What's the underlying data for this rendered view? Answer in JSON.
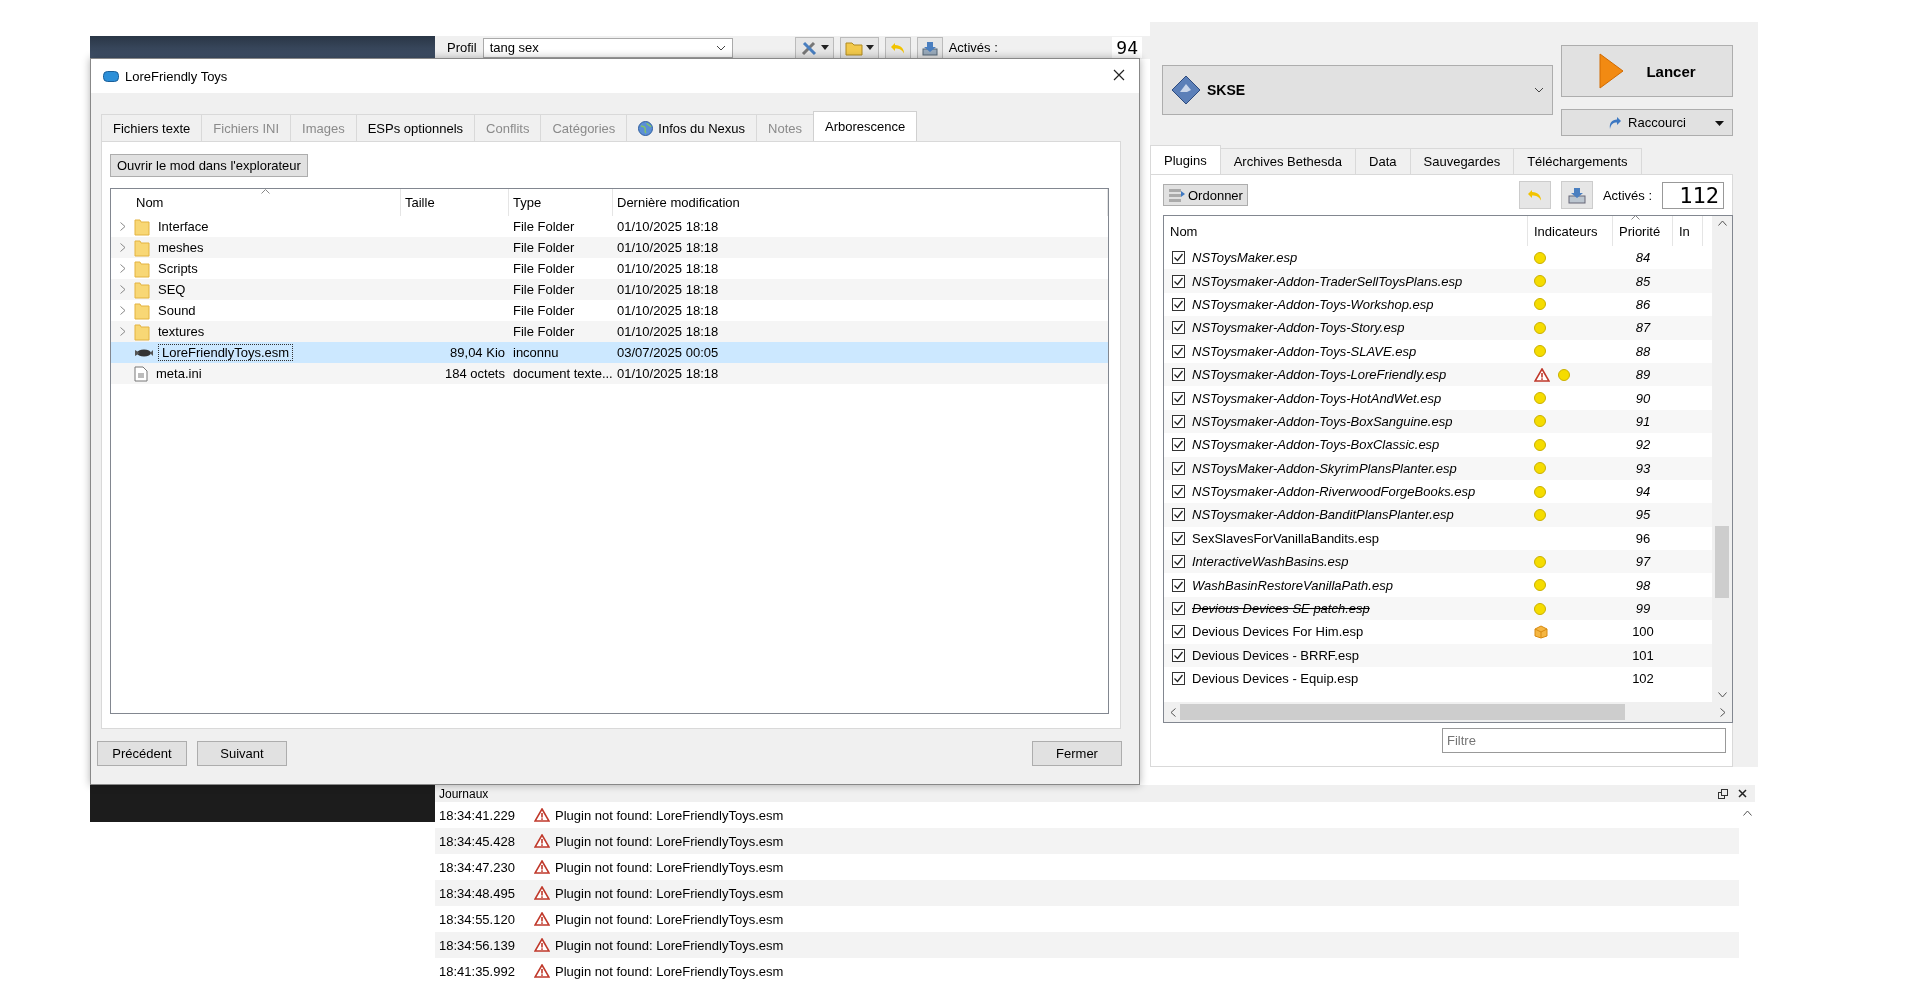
{
  "main_toolbar": {
    "profile_label": "Profil",
    "profile": "tang sex",
    "active_label": "Activés :",
    "active_count": "94"
  },
  "dialog": {
    "title": "LoreFriendly Toys",
    "tabs": [
      {
        "label": "Fichiers texte",
        "selected": false,
        "disabled": false
      },
      {
        "label": "Fichiers INI",
        "selected": false,
        "disabled": true
      },
      {
        "label": "Images",
        "selected": false,
        "disabled": true
      },
      {
        "label": "ESPs optionnels",
        "selected": false,
        "disabled": false
      },
      {
        "label": "Conflits",
        "selected": false,
        "disabled": true
      },
      {
        "label": "Catégories",
        "selected": false,
        "disabled": true
      },
      {
        "label": "Infos du Nexus",
        "selected": false,
        "disabled": false,
        "kind": "web"
      },
      {
        "label": "Notes",
        "selected": false,
        "disabled": true
      },
      {
        "label": "Arborescence",
        "selected": true,
        "disabled": false
      }
    ],
    "open_button": "Ouvrir le mod dans l'explorateur",
    "tree": {
      "columns": [
        "Nom",
        "Taille",
        "Type",
        "Dernière modification"
      ],
      "rows": [
        {
          "kind": "folder",
          "name": "Interface",
          "type": "File Folder",
          "modified": "01/10/2025 18:18",
          "expanded": false,
          "selected": false
        },
        {
          "kind": "folder",
          "name": "meshes",
          "type": "File Folder",
          "modified": "01/10/2025 18:18",
          "expanded": false,
          "selected": false
        },
        {
          "kind": "folder",
          "name": "Scripts",
          "type": "File Folder",
          "modified": "01/10/2025 18:18",
          "expanded": false,
          "selected": false
        },
        {
          "kind": "folder",
          "name": "SEQ",
          "type": "File Folder",
          "modified": "01/10/2025 18:18",
          "expanded": false,
          "selected": false
        },
        {
          "kind": "folder",
          "name": "Sound",
          "type": "File Folder",
          "modified": "01/10/2025 18:18",
          "expanded": false,
          "selected": false
        },
        {
          "kind": "folder",
          "name": "textures",
          "type": "File Folder",
          "modified": "01/10/2025 18:18",
          "expanded": false,
          "selected": false
        },
        {
          "kind": "plugin",
          "name": "LoreFriendlyToys.esm",
          "size": "89,04 Kio",
          "type": "inconnu",
          "modified": "03/07/2025 00:05",
          "selected": true
        },
        {
          "kind": "ini",
          "name": "meta.ini",
          "size": "184 octets",
          "type": "document texte...",
          "modified": "01/10/2025 18:18",
          "selected": false
        }
      ]
    },
    "buttons": {
      "previous": "Précédent",
      "next": "Suivant",
      "close": "Fermer"
    }
  },
  "right_panel": {
    "executable": "SKSE",
    "launch": "Lancer",
    "shortcut": "Raccourci",
    "tabs": [
      {
        "label": "Plugins",
        "selected": true
      },
      {
        "label": "Archives Bethesda",
        "selected": false
      },
      {
        "label": "Data",
        "selected": false
      },
      {
        "label": "Sauvegardes",
        "selected": false
      },
      {
        "label": "Téléchargements",
        "selected": false
      }
    ],
    "sort_button": "Ordonner",
    "active_label": "Activés :",
    "active_count": "112",
    "plugins": {
      "columns": [
        "Nom",
        "Indicateurs",
        "Priorité",
        "In"
      ],
      "rows": [
        {
          "name": "NSToysMaker.esp",
          "checked": true,
          "kind": "light",
          "indicators": [
            {
              "kind": "dot"
            }
          ],
          "priority": "84"
        },
        {
          "name": "NSToysmaker-Addon-TraderSellToysPlans.esp",
          "checked": true,
          "kind": "light",
          "indicators": [
            {
              "kind": "dot"
            }
          ],
          "priority": "85"
        },
        {
          "name": "NSToysmaker-Addon-Toys-Workshop.esp",
          "checked": true,
          "kind": "light",
          "indicators": [
            {
              "kind": "dot"
            }
          ],
          "priority": "86"
        },
        {
          "name": "NSToysmaker-Addon-Toys-Story.esp",
          "checked": true,
          "kind": "light",
          "indicators": [
            {
              "kind": "dot"
            }
          ],
          "priority": "87"
        },
        {
          "name": "NSToysmaker-Addon-Toys-SLAVE.esp",
          "checked": true,
          "kind": "light",
          "indicators": [
            {
              "kind": "dot"
            }
          ],
          "priority": "88"
        },
        {
          "name": "NSToysmaker-Addon-Toys-LoreFriendly.esp",
          "checked": true,
          "kind": "light",
          "indicators": [
            {
              "kind": "warning"
            },
            {
              "kind": "dot"
            }
          ],
          "priority": "89"
        },
        {
          "name": "NSToysmaker-Addon-Toys-HotAndWet.esp",
          "checked": true,
          "kind": "light",
          "indicators": [
            {
              "kind": "dot"
            }
          ],
          "priority": "90"
        },
        {
          "name": "NSToysmaker-Addon-Toys-BoxSanguine.esp",
          "checked": true,
          "kind": "light",
          "indicators": [
            {
              "kind": "dot"
            }
          ],
          "priority": "91"
        },
        {
          "name": "NSToysmaker-Addon-Toys-BoxClassic.esp",
          "checked": true,
          "kind": "light",
          "indicators": [
            {
              "kind": "dot"
            }
          ],
          "priority": "92"
        },
        {
          "name": "NSToysMaker-Addon-SkyrimPlansPlanter.esp",
          "checked": true,
          "kind": "light",
          "indicators": [
            {
              "kind": "dot"
            }
          ],
          "priority": "93"
        },
        {
          "name": "NSToysmaker-Addon-RiverwoodForgeBooks.esp",
          "checked": true,
          "kind": "light",
          "indicators": [
            {
              "kind": "dot"
            }
          ],
          "priority": "94"
        },
        {
          "name": "NSToysmaker-Addon-BanditPlansPlanter.esp",
          "checked": true,
          "kind": "light",
          "indicators": [
            {
              "kind": "dot"
            }
          ],
          "priority": "95"
        },
        {
          "name": "SexSlavesForVanillaBandits.esp",
          "checked": true,
          "kind": "plain",
          "indicators": [],
          "priority": "96"
        },
        {
          "name": "InteractiveWashBasins.esp",
          "checked": true,
          "kind": "light",
          "indicators": [
            {
              "kind": "dot"
            }
          ],
          "priority": "97"
        },
        {
          "name": "WashBasinRestoreVanillaPath.esp",
          "checked": true,
          "kind": "light",
          "indicators": [
            {
              "kind": "dot"
            }
          ],
          "priority": "98"
        },
        {
          "name": "Devious Devices SE patch.esp",
          "checked": true,
          "kind": "struck",
          "indicators": [
            {
              "kind": "dot"
            }
          ],
          "priority": "99"
        },
        {
          "name": "Devious Devices For Him.esp",
          "checked": true,
          "kind": "plain",
          "indicators": [
            {
              "kind": "package"
            }
          ],
          "priority": "100"
        },
        {
          "name": "Devious Devices - BRRF.esp",
          "checked": true,
          "kind": "plain",
          "indicators": [],
          "priority": "101"
        },
        {
          "name": "Devious Devices - Equip.esp",
          "checked": true,
          "kind": "plain",
          "indicators": [],
          "priority": "102"
        }
      ]
    },
    "filter_placeholder": "Filtre"
  },
  "log": {
    "title": "Journaux",
    "entries": [
      {
        "time": "18:34:41.229",
        "kind": "warning",
        "message": "Plugin not found: LoreFriendlyToys.esm"
      },
      {
        "time": "18:34:45.428",
        "kind": "warning",
        "message": "Plugin not found: LoreFriendlyToys.esm"
      },
      {
        "time": "18:34:47.230",
        "kind": "warning",
        "message": "Plugin not found: LoreFriendlyToys.esm"
      },
      {
        "time": "18:34:48.495",
        "kind": "warning",
        "message": "Plugin not found: LoreFriendlyToys.esm"
      },
      {
        "time": "18:34:55.120",
        "kind": "warning",
        "message": "Plugin not found: LoreFriendlyToys.esm"
      },
      {
        "time": "18:34:56.139",
        "kind": "warning",
        "message": "Plugin not found: LoreFriendlyToys.esm"
      },
      {
        "time": "18:41:35.992",
        "kind": "warning",
        "message": "Plugin not found: LoreFriendlyToys.esm"
      }
    ]
  }
}
